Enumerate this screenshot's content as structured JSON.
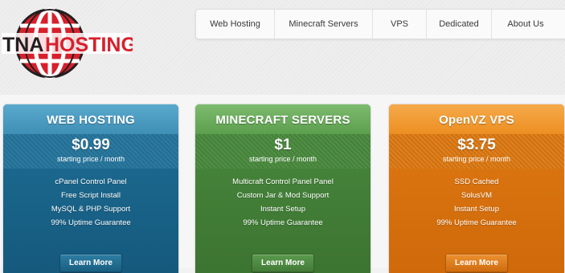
{
  "brand": {
    "name": "TNAHOSTING",
    "part1": "TNA",
    "part2": "HOSTING"
  },
  "nav": {
    "items": [
      {
        "label": "Web Hosting"
      },
      {
        "label": "Minecraft Servers"
      },
      {
        "label": "VPS"
      },
      {
        "label": "Dedicated"
      },
      {
        "label": "About Us"
      }
    ]
  },
  "plans": [
    {
      "title": "WEB HOSTING",
      "price": "$0.99",
      "price_note": "starting price / month",
      "features": [
        "cPanel Control Panel",
        "Free Script Install",
        "MySQL & PHP Support",
        "99% Uptime Guarantee"
      ],
      "button": "Learn More"
    },
    {
      "title": "MINECRAFT SERVERS",
      "price": "$1",
      "price_note": "starting price / month",
      "features": [
        "Multicraft Control Panel Panel",
        "Custom Jar & Mod Support",
        "Instant Setup",
        "99% Uptime Guarantee"
      ],
      "button": "Learn More"
    },
    {
      "title": "OpenVZ VPS",
      "price": "$3.75",
      "price_note": "starting price / month",
      "features": [
        "SSD Cached",
        "SolusVM",
        "Instant Setup",
        "99% Uptime Guarantee"
      ],
      "button": "Learn More"
    }
  ],
  "colors": {
    "brand_red": "#d8202c",
    "brand_dark": "#231f20",
    "web_hosting": "#3f8fb6",
    "minecraft": "#5c9f4e",
    "vps": "#ec8f22"
  }
}
